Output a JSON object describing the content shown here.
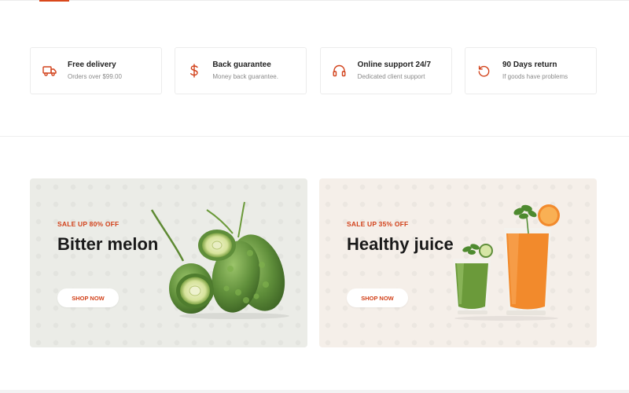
{
  "features": [
    {
      "icon": "truck-icon",
      "title": "Free delivery",
      "subtitle": "Orders over $99.00"
    },
    {
      "icon": "dollar-icon",
      "title": "Back guarantee",
      "subtitle": "Money back guarantee."
    },
    {
      "icon": "headphones-icon",
      "title": "Online support 24/7",
      "subtitle": "Dedicated client support"
    },
    {
      "icon": "refresh-icon",
      "title": "90 Days return",
      "subtitle": "If goods have problems"
    }
  ],
  "banners": [
    {
      "sale": "SALE UP 80% OFF",
      "title": "Bitter melon",
      "button": "SHOP NOW",
      "image": "bitter-melon-image"
    },
    {
      "sale": "SALE UP 35% OFF",
      "title": "Healthy juice",
      "button": "SHOP NOW",
      "image": "juice-glasses-image"
    }
  ],
  "colors": {
    "accent": "#d2421b",
    "banner_left_bg": "#ebece7",
    "banner_right_bg": "#f5efe9"
  }
}
